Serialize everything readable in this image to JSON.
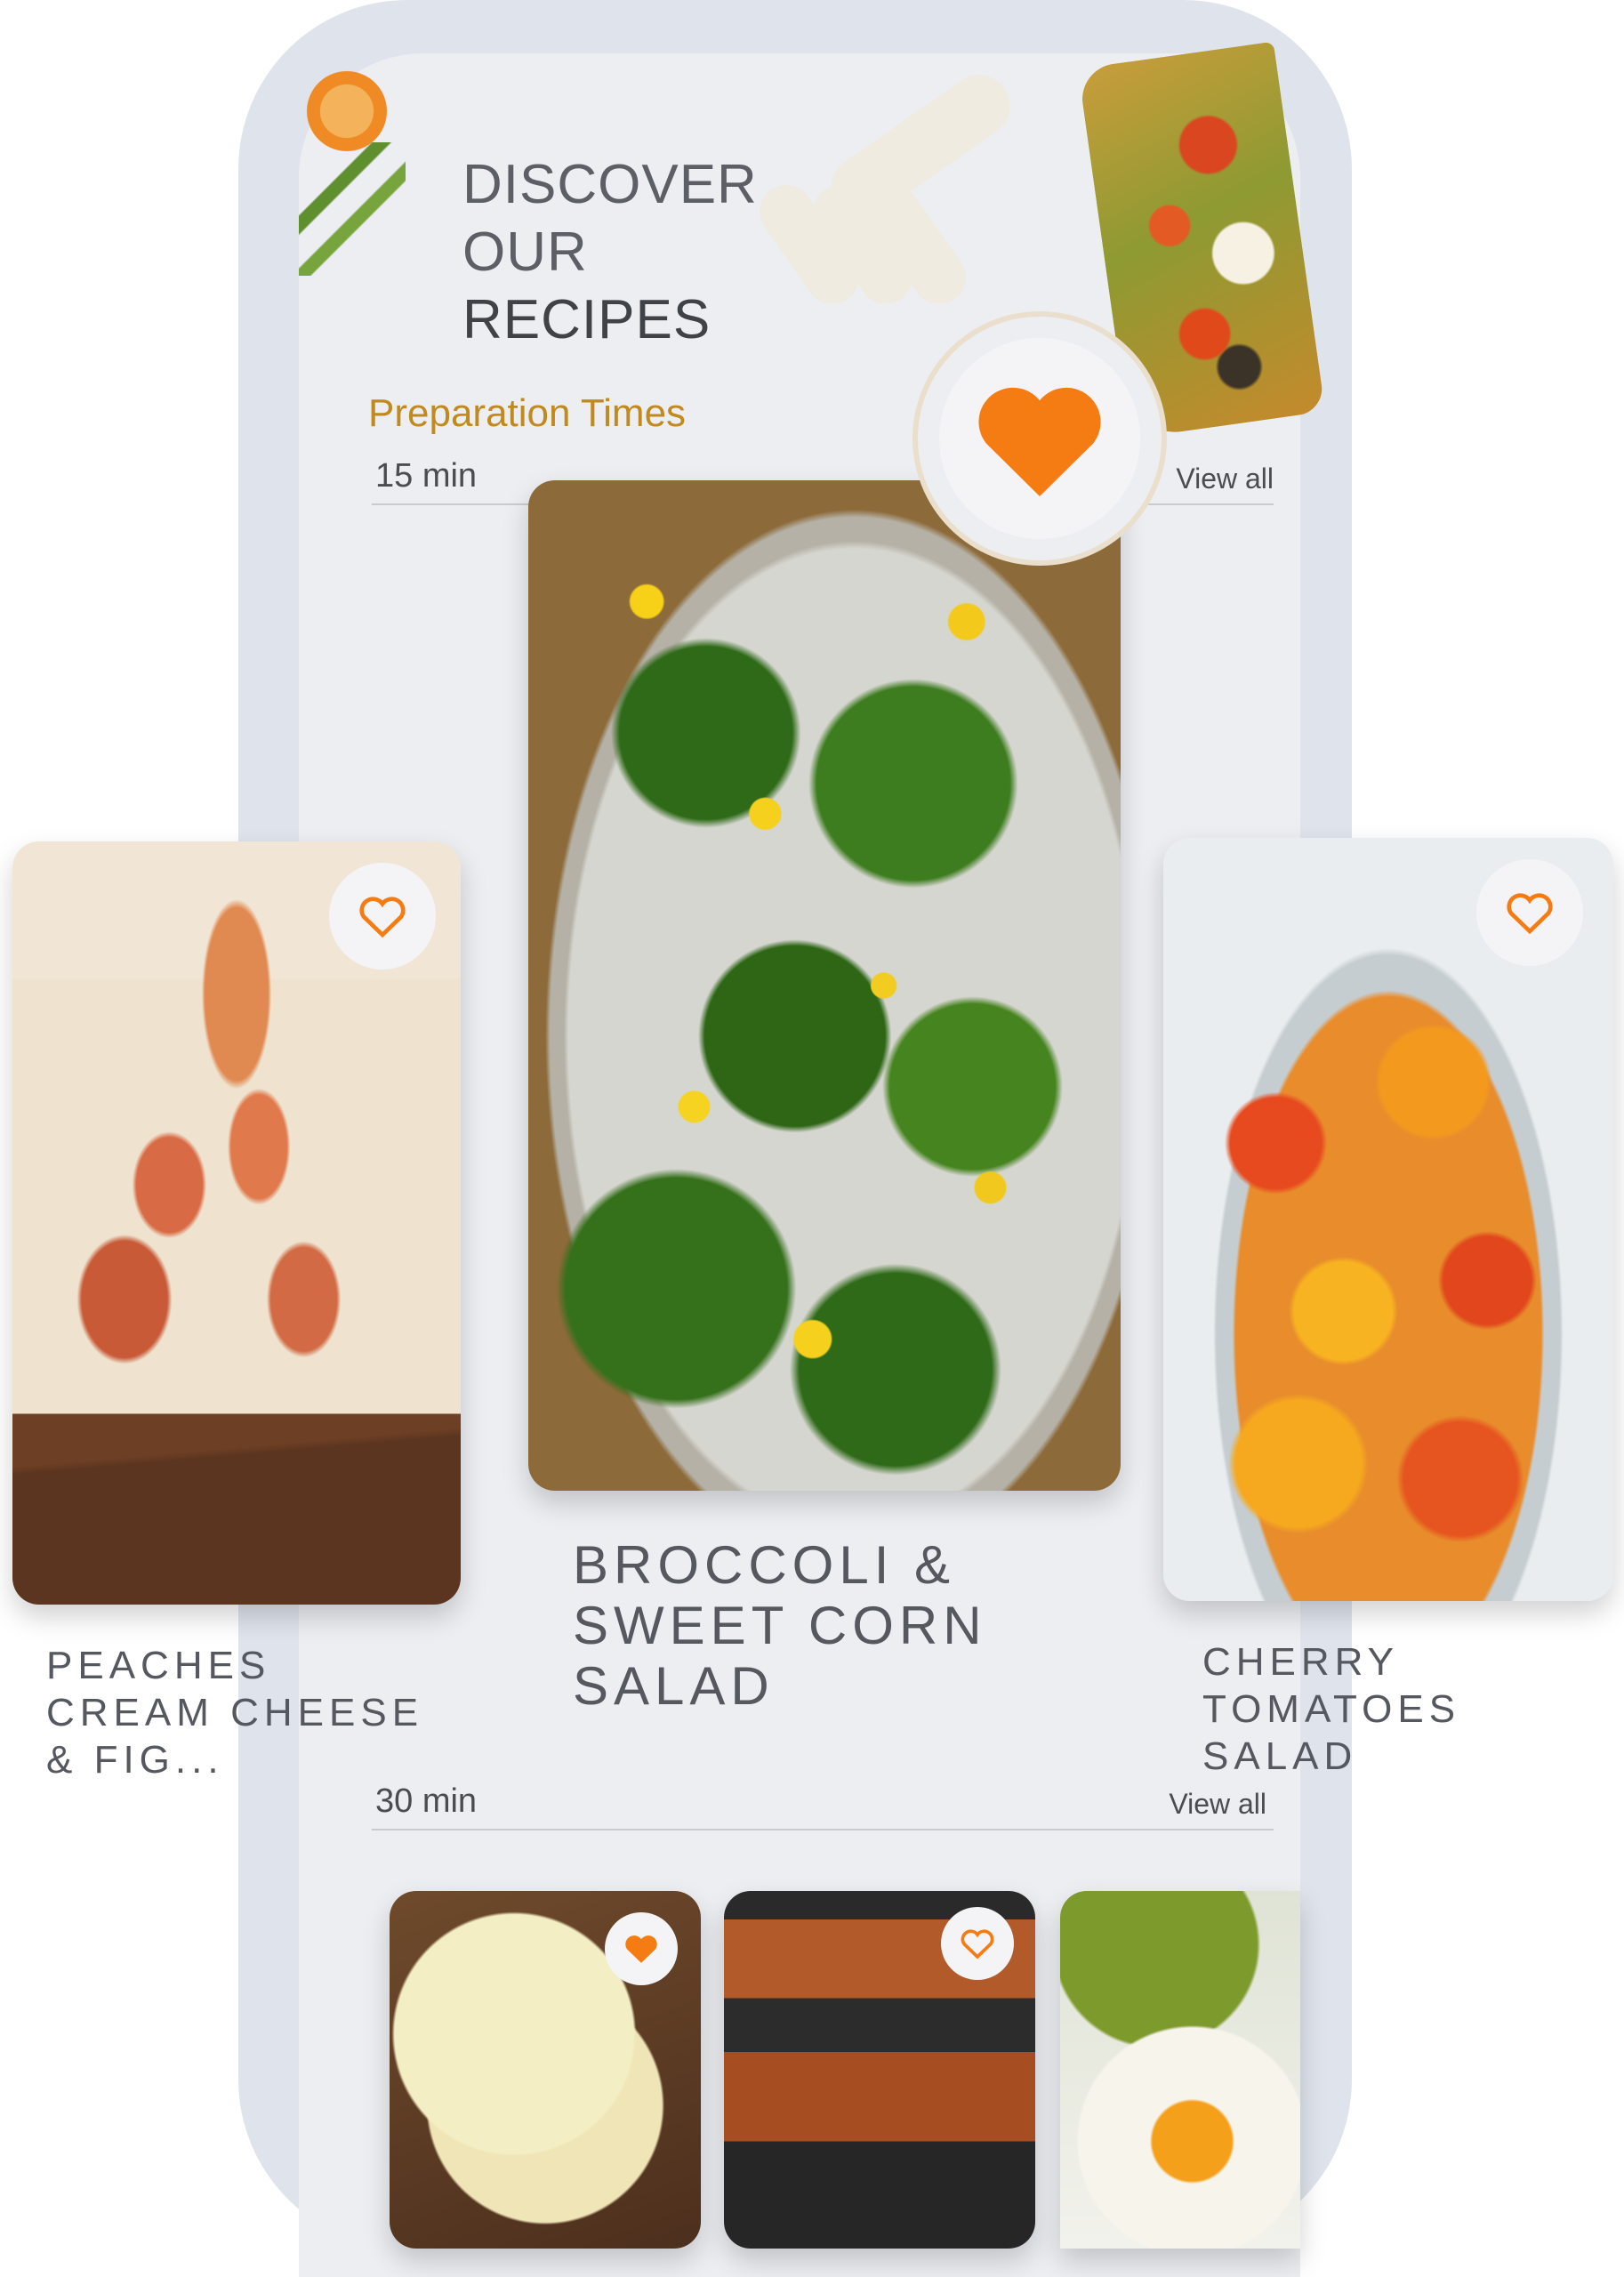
{
  "header": {
    "title_lines": [
      "DISCOVER",
      "OUR",
      "RECIPES"
    ]
  },
  "preparation": {
    "label": "Preparation Times",
    "sections": [
      {
        "time": "15 min",
        "view_all": "View all"
      },
      {
        "time": "30 min",
        "view_all": "View all"
      }
    ]
  },
  "featured": {
    "favorite_icon": "heart-icon",
    "accent_color": "#f47c13"
  },
  "recipes_15min": [
    {
      "name_lines": [
        "PEACHES",
        "CREAM CHEESE",
        "& FIG..."
      ],
      "favorited": false
    },
    {
      "name_lines": [
        "BROCCOLI &",
        "SWEET CORN",
        "SALAD"
      ],
      "favorited": true
    },
    {
      "name_lines": [
        "CHERRY",
        "TOMATOES",
        "SALAD"
      ],
      "favorited": false
    }
  ],
  "recipes_30min": [
    {
      "favorited": true
    },
    {
      "favorited": false
    },
    {
      "favorited": false
    }
  ]
}
